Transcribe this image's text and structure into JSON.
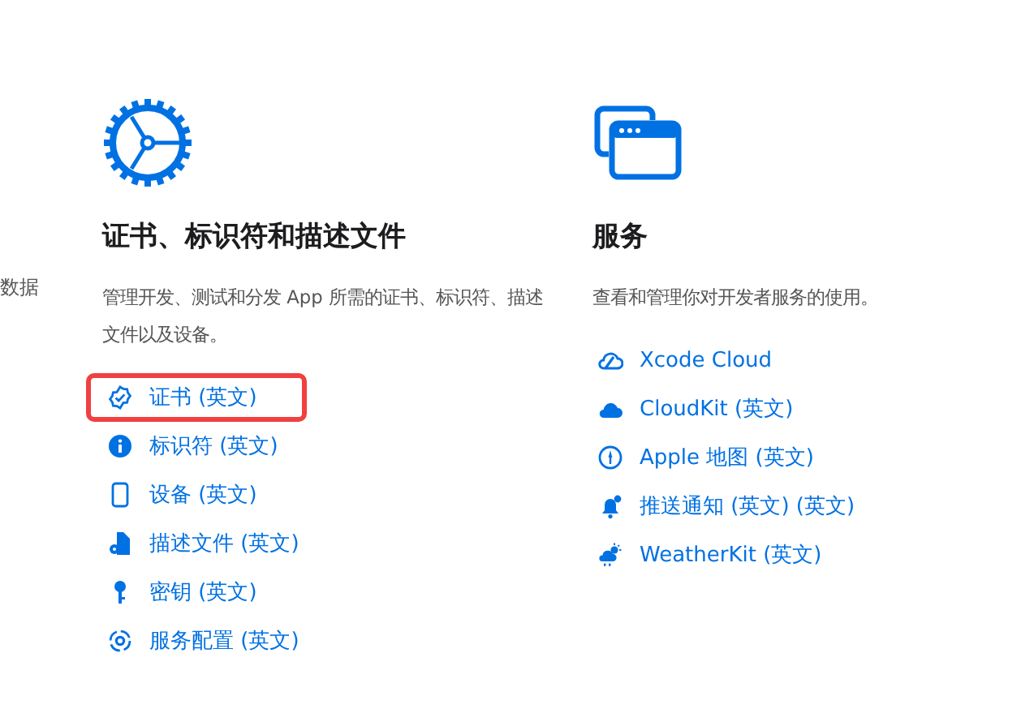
{
  "left_fragment": {
    "description": "数据"
  },
  "sections": [
    {
      "kind": "gear",
      "title": "证书、标识符和描述文件",
      "description": "管理开发、测试和分发 App 所需的证书、标识符、描述文件以及设备。",
      "links": [
        {
          "kind": "badge",
          "label": "证书 (英文)",
          "highlighted": true
        },
        {
          "kind": "info",
          "label": "标识符 (英文)",
          "highlighted": false
        },
        {
          "kind": "phone",
          "label": "设备 (英文)",
          "highlighted": false
        },
        {
          "kind": "file",
          "label": "描述文件 (英文)",
          "highlighted": false
        },
        {
          "kind": "key",
          "label": "密钥 (英文)",
          "highlighted": false
        },
        {
          "kind": "sync",
          "label": "服务配置 (英文)",
          "highlighted": false
        }
      ]
    },
    {
      "kind": "windows",
      "title": "服务",
      "description": "查看和管理你对开发者服务的使用。",
      "links": [
        {
          "kind": "xcloud",
          "label": "Xcode Cloud",
          "highlighted": false
        },
        {
          "kind": "cloud",
          "label": "CloudKit (英文)",
          "highlighted": false
        },
        {
          "kind": "map",
          "label": "Apple 地图 (英文)",
          "highlighted": false
        },
        {
          "kind": "bell",
          "label": "推送通知 (英文) (英文)",
          "highlighted": false
        },
        {
          "kind": "weather",
          "label": "WeatherKit (英文)",
          "highlighted": false
        }
      ]
    }
  ]
}
